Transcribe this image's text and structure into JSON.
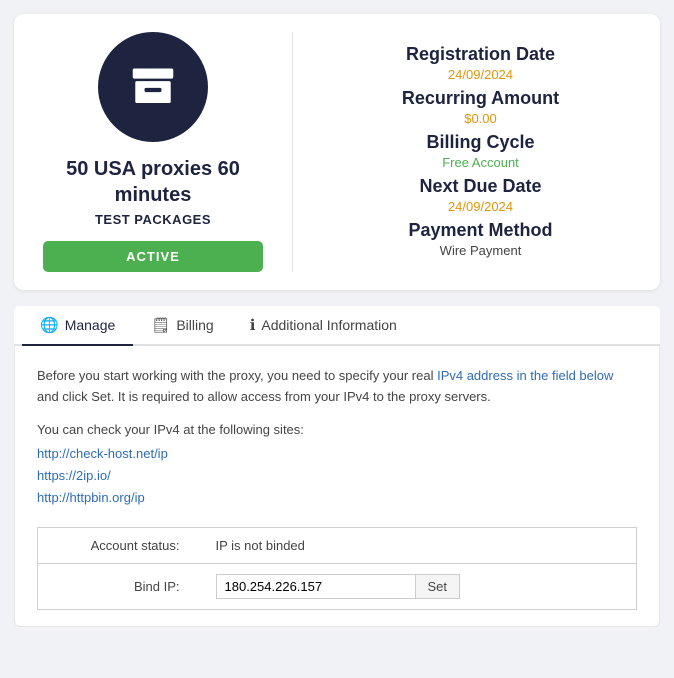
{
  "topCard": {
    "iconAlt": "box-archive-icon",
    "productTitle": "50 USA proxies 60 minutes",
    "productSubtitle": "TEST PACKAGES",
    "activeBadge": "ACTIVE",
    "registrationDateLabel": "Registration Date",
    "registrationDateValue": "24/09/2024",
    "recurringAmountLabel": "Recurring Amount",
    "recurringAmountValue": "$0.00",
    "billingCycleLabel": "Billing Cycle",
    "billingCycleValue": "Free Account",
    "nextDueDateLabel": "Next Due Date",
    "nextDueDateValue": "24/09/2024",
    "paymentMethodLabel": "Payment Method",
    "paymentMethodValue": "Wire Payment"
  },
  "tabs": [
    {
      "id": "manage",
      "label": "Manage",
      "icon": "globe",
      "active": true
    },
    {
      "id": "billing",
      "label": "Billing",
      "icon": "file",
      "active": false
    },
    {
      "id": "additional",
      "label": "Additional Information",
      "icon": "info",
      "active": false
    }
  ],
  "content": {
    "description": "Before you start working with the proxy, you need to specify your real IPv4 address in the field below and click Set. It is required to allow access from your IPv4 to the proxy servers.",
    "linksHeader": "You can check your IPv4 at the following sites:",
    "links": [
      "http://check-host.net/ip",
      "https://2ip.io/",
      "http://httpbin.org/ip"
    ],
    "accountStatusLabel": "Account status:",
    "accountStatusValue": "IP is not binded",
    "bindIPLabel": "Bind IP:",
    "bindIPValue": "180.254.226.157",
    "setButtonLabel": "Set"
  }
}
